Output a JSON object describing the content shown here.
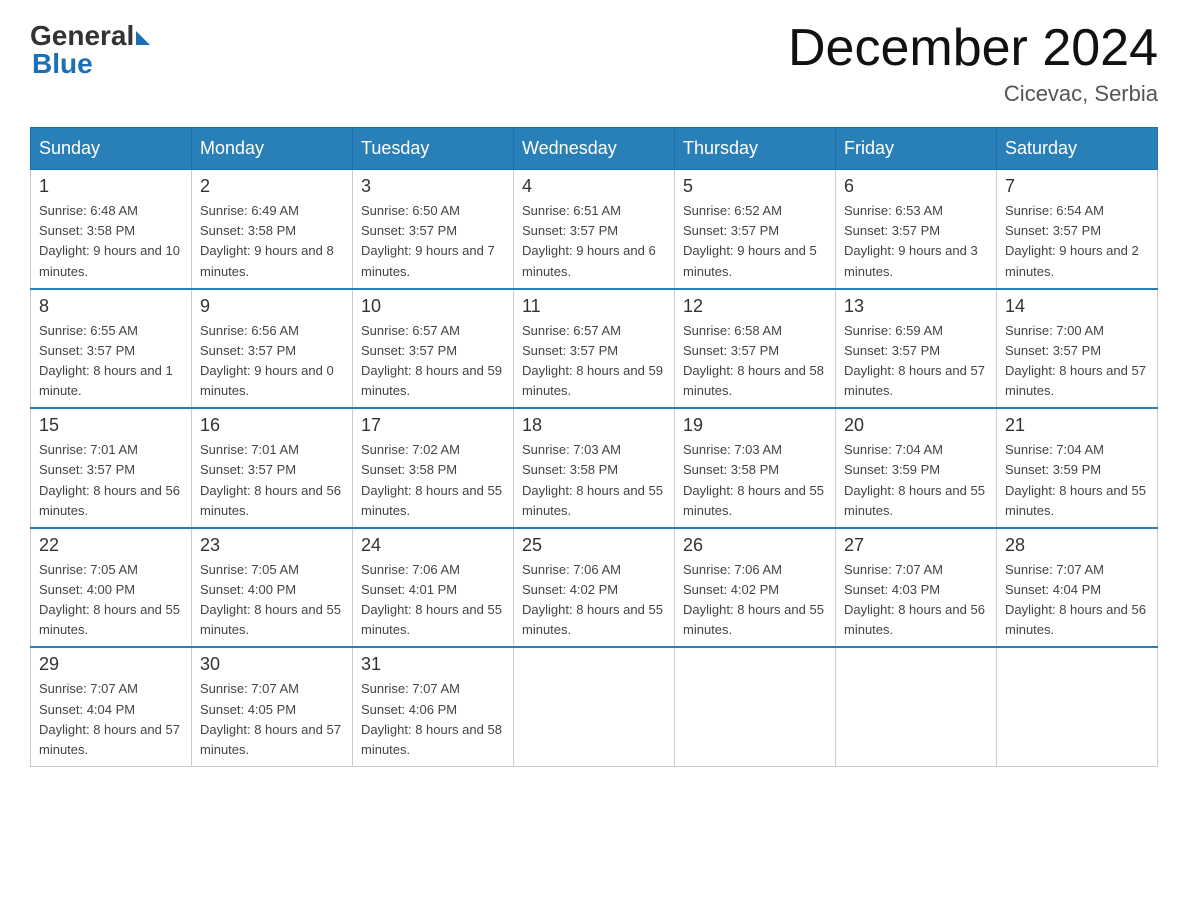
{
  "header": {
    "logo_general": "General",
    "logo_blue": "Blue",
    "month_title": "December 2024",
    "location": "Cicevac, Serbia"
  },
  "days_of_week": [
    "Sunday",
    "Monday",
    "Tuesday",
    "Wednesday",
    "Thursday",
    "Friday",
    "Saturday"
  ],
  "weeks": [
    [
      {
        "num": "1",
        "sunrise": "6:48 AM",
        "sunset": "3:58 PM",
        "daylight": "9 hours and 10 minutes."
      },
      {
        "num": "2",
        "sunrise": "6:49 AM",
        "sunset": "3:58 PM",
        "daylight": "9 hours and 8 minutes."
      },
      {
        "num": "3",
        "sunrise": "6:50 AM",
        "sunset": "3:57 PM",
        "daylight": "9 hours and 7 minutes."
      },
      {
        "num": "4",
        "sunrise": "6:51 AM",
        "sunset": "3:57 PM",
        "daylight": "9 hours and 6 minutes."
      },
      {
        "num": "5",
        "sunrise": "6:52 AM",
        "sunset": "3:57 PM",
        "daylight": "9 hours and 5 minutes."
      },
      {
        "num": "6",
        "sunrise": "6:53 AM",
        "sunset": "3:57 PM",
        "daylight": "9 hours and 3 minutes."
      },
      {
        "num": "7",
        "sunrise": "6:54 AM",
        "sunset": "3:57 PM",
        "daylight": "9 hours and 2 minutes."
      }
    ],
    [
      {
        "num": "8",
        "sunrise": "6:55 AM",
        "sunset": "3:57 PM",
        "daylight": "8 hours and 1 minute."
      },
      {
        "num": "9",
        "sunrise": "6:56 AM",
        "sunset": "3:57 PM",
        "daylight": "9 hours and 0 minutes."
      },
      {
        "num": "10",
        "sunrise": "6:57 AM",
        "sunset": "3:57 PM",
        "daylight": "8 hours and 59 minutes."
      },
      {
        "num": "11",
        "sunrise": "6:57 AM",
        "sunset": "3:57 PM",
        "daylight": "8 hours and 59 minutes."
      },
      {
        "num": "12",
        "sunrise": "6:58 AM",
        "sunset": "3:57 PM",
        "daylight": "8 hours and 58 minutes."
      },
      {
        "num": "13",
        "sunrise": "6:59 AM",
        "sunset": "3:57 PM",
        "daylight": "8 hours and 57 minutes."
      },
      {
        "num": "14",
        "sunrise": "7:00 AM",
        "sunset": "3:57 PM",
        "daylight": "8 hours and 57 minutes."
      }
    ],
    [
      {
        "num": "15",
        "sunrise": "7:01 AM",
        "sunset": "3:57 PM",
        "daylight": "8 hours and 56 minutes."
      },
      {
        "num": "16",
        "sunrise": "7:01 AM",
        "sunset": "3:57 PM",
        "daylight": "8 hours and 56 minutes."
      },
      {
        "num": "17",
        "sunrise": "7:02 AM",
        "sunset": "3:58 PM",
        "daylight": "8 hours and 55 minutes."
      },
      {
        "num": "18",
        "sunrise": "7:03 AM",
        "sunset": "3:58 PM",
        "daylight": "8 hours and 55 minutes."
      },
      {
        "num": "19",
        "sunrise": "7:03 AM",
        "sunset": "3:58 PM",
        "daylight": "8 hours and 55 minutes."
      },
      {
        "num": "20",
        "sunrise": "7:04 AM",
        "sunset": "3:59 PM",
        "daylight": "8 hours and 55 minutes."
      },
      {
        "num": "21",
        "sunrise": "7:04 AM",
        "sunset": "3:59 PM",
        "daylight": "8 hours and 55 minutes."
      }
    ],
    [
      {
        "num": "22",
        "sunrise": "7:05 AM",
        "sunset": "4:00 PM",
        "daylight": "8 hours and 55 minutes."
      },
      {
        "num": "23",
        "sunrise": "7:05 AM",
        "sunset": "4:00 PM",
        "daylight": "8 hours and 55 minutes."
      },
      {
        "num": "24",
        "sunrise": "7:06 AM",
        "sunset": "4:01 PM",
        "daylight": "8 hours and 55 minutes."
      },
      {
        "num": "25",
        "sunrise": "7:06 AM",
        "sunset": "4:02 PM",
        "daylight": "8 hours and 55 minutes."
      },
      {
        "num": "26",
        "sunrise": "7:06 AM",
        "sunset": "4:02 PM",
        "daylight": "8 hours and 55 minutes."
      },
      {
        "num": "27",
        "sunrise": "7:07 AM",
        "sunset": "4:03 PM",
        "daylight": "8 hours and 56 minutes."
      },
      {
        "num": "28",
        "sunrise": "7:07 AM",
        "sunset": "4:04 PM",
        "daylight": "8 hours and 56 minutes."
      }
    ],
    [
      {
        "num": "29",
        "sunrise": "7:07 AM",
        "sunset": "4:04 PM",
        "daylight": "8 hours and 57 minutes."
      },
      {
        "num": "30",
        "sunrise": "7:07 AM",
        "sunset": "4:05 PM",
        "daylight": "8 hours and 57 minutes."
      },
      {
        "num": "31",
        "sunrise": "7:07 AM",
        "sunset": "4:06 PM",
        "daylight": "8 hours and 58 minutes."
      },
      null,
      null,
      null,
      null
    ]
  ]
}
